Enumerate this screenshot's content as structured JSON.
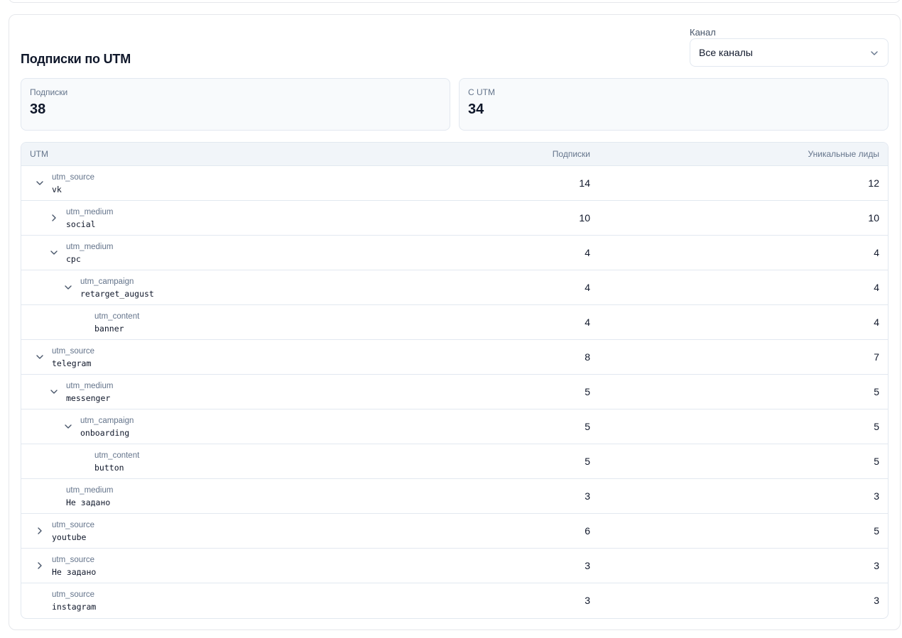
{
  "title": "Подписки по UTM",
  "filter": {
    "label": "Канал",
    "value": "Все каналы"
  },
  "stats": [
    {
      "label": "Подписки",
      "value": "38"
    },
    {
      "label": "С UTM",
      "value": "34"
    }
  ],
  "table": {
    "headers": {
      "utm": "UTM",
      "subs": "Подписки",
      "leads": "Уникальные лиды"
    },
    "rows": [
      {
        "key": "utm_source",
        "value": "vk",
        "subs": "14",
        "leads": "12",
        "level": 0,
        "chevron": "down"
      },
      {
        "key": "utm_medium",
        "value": "social",
        "subs": "10",
        "leads": "10",
        "level": 1,
        "chevron": "right"
      },
      {
        "key": "utm_medium",
        "value": "cpc",
        "subs": "4",
        "leads": "4",
        "level": 1,
        "chevron": "down"
      },
      {
        "key": "utm_campaign",
        "value": "retarget_august",
        "subs": "4",
        "leads": "4",
        "level": 2,
        "chevron": "down"
      },
      {
        "key": "utm_content",
        "value": "banner",
        "subs": "4",
        "leads": "4",
        "level": 3,
        "chevron": "none"
      },
      {
        "key": "utm_source",
        "value": "telegram",
        "subs": "8",
        "leads": "7",
        "level": 0,
        "chevron": "down"
      },
      {
        "key": "utm_medium",
        "value": "messenger",
        "subs": "5",
        "leads": "5",
        "level": 1,
        "chevron": "down"
      },
      {
        "key": "utm_campaign",
        "value": "onboarding",
        "subs": "5",
        "leads": "5",
        "level": 2,
        "chevron": "down"
      },
      {
        "key": "utm_content",
        "value": "button",
        "subs": "5",
        "leads": "5",
        "level": 3,
        "chevron": "none"
      },
      {
        "key": "utm_medium",
        "value": "Не задано",
        "subs": "3",
        "leads": "3",
        "level": 1,
        "chevron": "none"
      },
      {
        "key": "utm_source",
        "value": "youtube",
        "subs": "6",
        "leads": "5",
        "level": 0,
        "chevron": "right"
      },
      {
        "key": "utm_source",
        "value": "Не задано",
        "subs": "3",
        "leads": "3",
        "level": 0,
        "chevron": "right"
      },
      {
        "key": "utm_source",
        "value": "instagram",
        "subs": "3",
        "leads": "3",
        "level": 0,
        "chevron": "none"
      }
    ]
  },
  "icons": {
    "select": "chevron-down-icon",
    "expanded": "chevron-down-icon",
    "collapsed": "chevron-right-icon"
  },
  "colors": {
    "border": "#e2e8f0",
    "muted": "#64748b",
    "header_bg": "#f1f5f9",
    "stat_bg": "#f8fafc"
  }
}
